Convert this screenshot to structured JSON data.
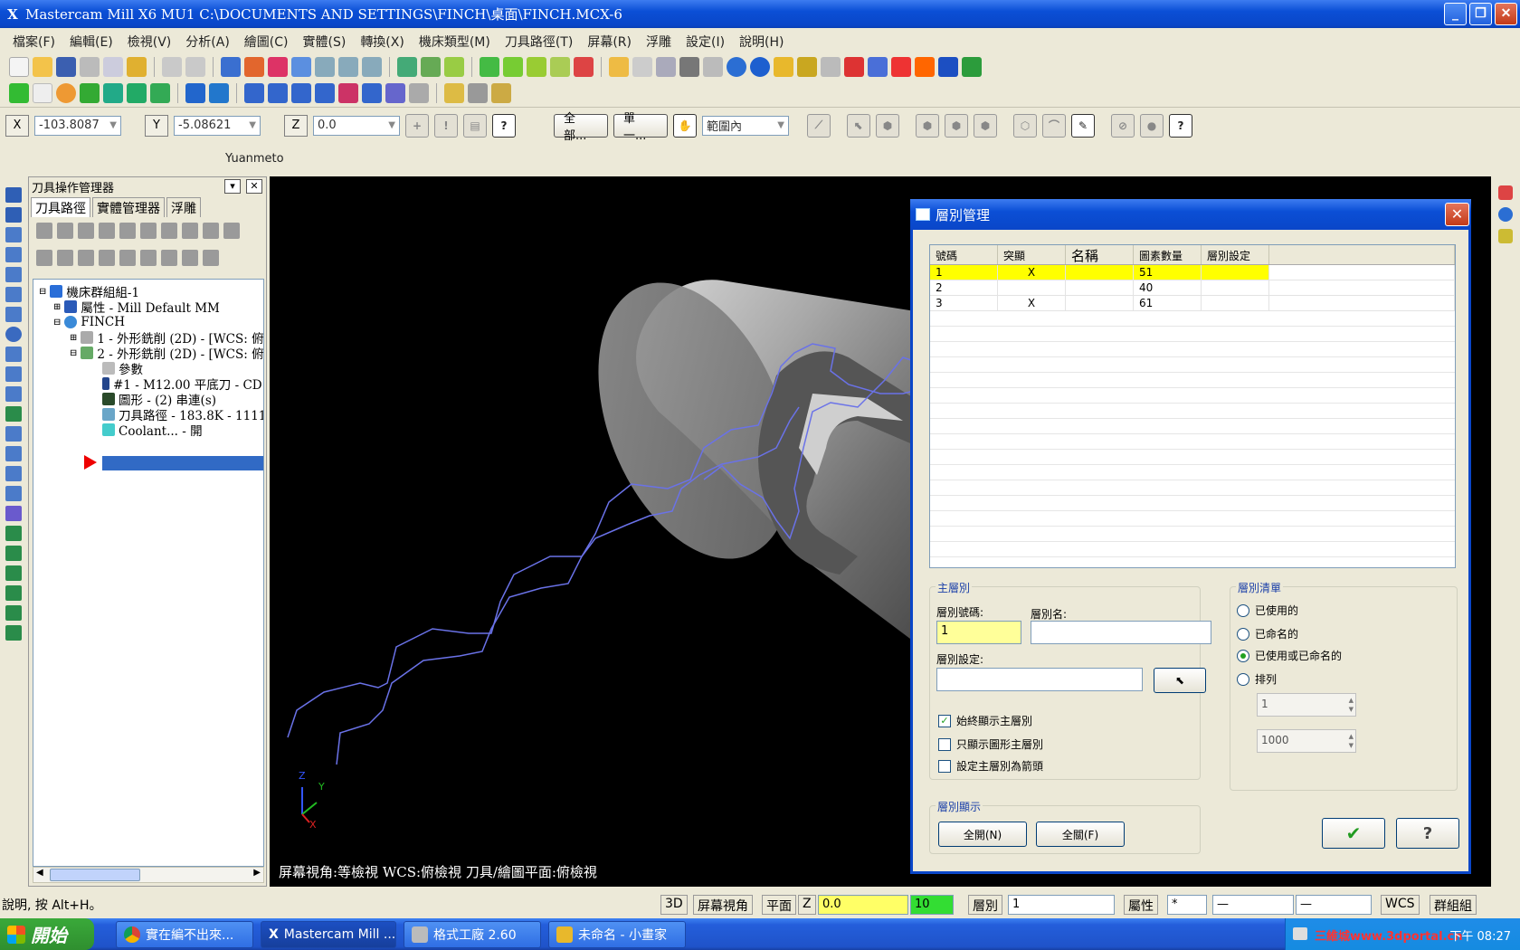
{
  "window": {
    "title": "Mastercam Mill X6 MU1  C:\\DOCUMENTS AND SETTINGS\\FINCH\\桌面\\FINCH.MCX-6",
    "min": "_",
    "max": "❐",
    "close": "✕"
  },
  "menu": [
    "檔案(F)",
    "編輯(E)",
    "檢視(V)",
    "分析(A)",
    "繪圖(C)",
    "實體(S)",
    "轉換(X)",
    "機床類型(M)",
    "刀具路徑(T)",
    "屏幕(R)",
    "浮雕",
    "設定(I)",
    "說明(H)"
  ],
  "coords": {
    "x_label": "X",
    "x_value": "-103.8087",
    "y_label": "Y",
    "y_value": "-5.08621",
    "z_label": "Z",
    "z_value": "0.0",
    "all_btn": "全部...",
    "single_btn": "單一...",
    "range_select": "範圍內"
  },
  "strip_text": "Yuanmeto",
  "ops_manager": {
    "title": "刀具操作管理器",
    "tabs": [
      "刀具路徑",
      "實體管理器",
      "浮雕"
    ],
    "tree": [
      "機床群組組-1",
      "屬性 - Mill Default MM",
      "FINCH",
      "1 - 外形銑削 (2D) - [WCS: 俯",
      "2 - 外形銑削 (2D) - [WCS: 俯",
      "參數",
      "#1 - M12.00 平底刀 - CD",
      "圖形 - (2) 串連(s)",
      "刀具路徑 - 183.8K - 1111",
      "Coolant... - 開"
    ]
  },
  "viewport": {
    "status": "屏幕視角:等檢視    WCS:俯檢視    刀具/繪圖平面:俯檢視",
    "axis_z": "Z",
    "axis_y": "Y",
    "axis_x": "X"
  },
  "level_dialog": {
    "title": "層別管理",
    "columns": [
      "號碼",
      "突顯",
      "名稱",
      "圖素數量",
      "層別設定"
    ],
    "rows": [
      {
        "num": "1",
        "highlight": "X",
        "name": "",
        "count": "51",
        "set": ""
      },
      {
        "num": "2",
        "highlight": "",
        "name": "",
        "count": "40",
        "set": ""
      },
      {
        "num": "3",
        "highlight": "X",
        "name": "",
        "count": "61",
        "set": ""
      }
    ],
    "main_group": "主層別",
    "level_number_label": "層別號碼:",
    "level_number_value": "1",
    "level_name_label": "層別名:",
    "level_name_value": "",
    "level_set_label": "層別設定:",
    "level_set_value": "",
    "chk_always_show": "始終顯示主層別",
    "chk_show_geom_only": "只顯示圖形主層別",
    "chk_set_arrow": "設定主層別為箭頭",
    "list_group": "層別清單",
    "radio_used": "已使用的",
    "radio_named": "已命名的",
    "radio_used_or_named": "已使用或已命名的",
    "radio_range": "排列",
    "range_from": "1",
    "range_to": "1000",
    "display_group": "層別顯示",
    "all_on": "全開(N)",
    "all_off": "全關(F)",
    "ok": "✔",
    "help": "?"
  },
  "statusbar": {
    "help": "說明, 按 Alt+H。",
    "mode_3d": "3D",
    "screen_view": "屏幕視角",
    "plane": "平面",
    "z_label": "Z",
    "z_value": "0.0",
    "color_value": "10",
    "level_label": "層別",
    "level_value": "1",
    "attr": "屬性",
    "wcs": "WCS",
    "group": "群組組"
  },
  "taskbar": {
    "start": "開始",
    "tasks": [
      "實在編不出來...",
      "Mastercam Mill ...",
      "格式工廠 2.60",
      "未命名 - 小畫家"
    ],
    "watermark": "三維城www.3dportal.cn",
    "clock": "下午 08:27"
  }
}
